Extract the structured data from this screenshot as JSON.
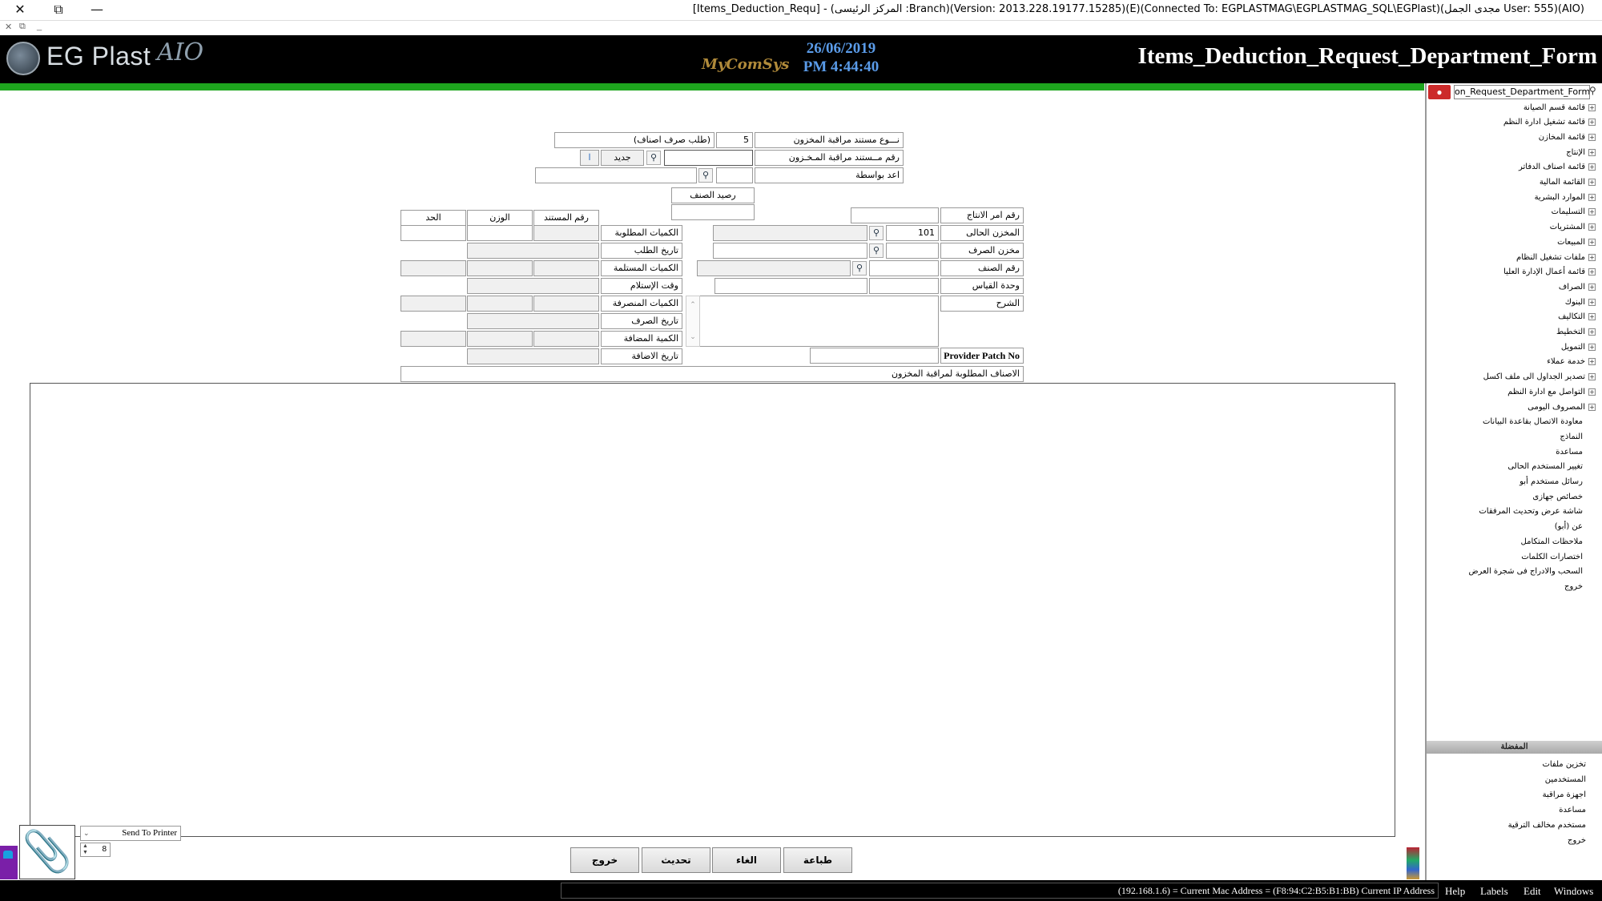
{
  "window": {
    "title": "[Items_Deduction_Requ] - (المركز الرئيسى :Branch)(Version: 2013.228.19177.15285)(E)(Connected To: EGPLASTMAG\\EGPLASTMAG_SQL\\EGPlast)(مجدى الجمل User: 555)(AIO)",
    "close": "✕",
    "restore": "⧉",
    "minimize": "—",
    "sub_close": "✕",
    "sub_restore": "⧉",
    "sub_min": "_"
  },
  "header": {
    "logo_text": "EG Plast",
    "logo_suffix": "AIO",
    "brand": "MyComSys",
    "date": "26/06/2019",
    "time": "PM 4:44:40",
    "form_title": "Items_Deduction_Request_Department_Form"
  },
  "sidebar": {
    "search_value": "on_Request_Department_Form",
    "items": [
      {
        "label": "قائمة قسم الصيانة",
        "expandable": true
      },
      {
        "label": "قائمة تشغيل ادارة النظم",
        "expandable": true
      },
      {
        "label": "قائمة المخازن",
        "expandable": true
      },
      {
        "label": "الإنتاج",
        "expandable": true
      },
      {
        "label": "قائمة اصناف الدفاتر",
        "expandable": true
      },
      {
        "label": "القائمة المالية",
        "expandable": true
      },
      {
        "label": "الموارد البشرية",
        "expandable": true
      },
      {
        "label": "التسليمات",
        "expandable": true
      },
      {
        "label": "المشتريات",
        "expandable": true
      },
      {
        "label": "المبيعات",
        "expandable": true
      },
      {
        "label": "ملفات تشغيل النظام",
        "expandable": true
      },
      {
        "label": "قائمة أعمال الإدارة العليا",
        "expandable": true
      },
      {
        "label": "الصراف",
        "expandable": true
      },
      {
        "label": "البنوك",
        "expandable": true
      },
      {
        "label": "التكاليف",
        "expandable": true
      },
      {
        "label": "التخطيط",
        "expandable": true
      },
      {
        "label": "التمويل",
        "expandable": true
      },
      {
        "label": "خدمة عملاء",
        "expandable": true
      },
      {
        "label": "تصدير الجداول الى ملف اكسل",
        "expandable": true
      },
      {
        "label": "التواصل مع ادارة النظم",
        "expandable": true
      },
      {
        "label": "المصروف اليومى",
        "expandable": true
      },
      {
        "label": "معاودة الاتصال بقاعدة البيانات",
        "expandable": false
      },
      {
        "label": "النماذج",
        "expandable": false
      },
      {
        "label": "مساعدة",
        "expandable": false
      },
      {
        "label": "تغيير المستخدم الحالى",
        "expandable": false
      },
      {
        "label": "رسائل مستخدم أبو",
        "expandable": false
      },
      {
        "label": "خصائص جهازى",
        "expandable": false
      },
      {
        "label": "شاشة عرض وتحديث المرفقات",
        "expandable": false
      },
      {
        "label": "عن (أبو)",
        "expandable": false
      },
      {
        "label": "ملاحظات المتكامل",
        "expandable": false
      },
      {
        "label": "اختصارات الكلمات",
        "expandable": false
      },
      {
        "label": "السحب والادراج فى شجرة العرض",
        "expandable": false
      },
      {
        "label": "خروج",
        "expandable": false
      }
    ],
    "favorites_title": "المفضلة",
    "favorites": [
      "تخزين ملفات",
      "المستخدمين",
      "اجهزة مراقبة",
      "مساعدة",
      "مستخدم مخالف الترقية",
      "خروج"
    ]
  },
  "form": {
    "doc_type_label": "نـــوع مستند مراقبة المخزون",
    "doc_type_code": "5",
    "doc_type_name": "(طلب صرف اصناف)",
    "doc_no_label": "رقم مــستند مراقبة المـخـزون",
    "doc_no_value": "",
    "new_label": "جديد",
    "new_aux": "ا",
    "prepared_by_label": "اعد بواسطة",
    "item_balance_label": "رصيد الصنف",
    "prod_order_label": "رقم امر الانتاج",
    "current_store_label": "المخزن الحالى",
    "current_store_value": "101",
    "issue_store_label": "مخزن الصرف",
    "item_no_label": "رقم الصنف",
    "unit_label": "وحدة القياس",
    "description_label": "الشرح",
    "provider_label": "Provider Patch No",
    "col_doc_no": "رقم المستند",
    "col_weight": "الوزن",
    "col_limit": "الحد",
    "req_qty_label": "الكميات المطلوبة",
    "req_date_label": "تاريخ الطلب",
    "recv_qty_label": "الكميات المستلمة",
    "recv_time_label": "وقت الإستلام",
    "issued_qty_label": "الكميات المنصرفة",
    "issue_date_label": "تاريخ الصرف",
    "added_qty_label": "الكمية المضافة",
    "add_date_label": "تاريخ الاضافة",
    "grid_caption": "الاصناف المطلوبة لمراقبة المخزون"
  },
  "footer": {
    "printer_label": "Send To Printer",
    "copies": "8",
    "buttons": {
      "print": "طباعة",
      "cancel": "الغاء",
      "refresh": "تحديث",
      "exit": "خروج"
    }
  },
  "statusbar": {
    "text": "(192.168.1.6) = Current Mac Address = (F8:94:C2:B5:B1:BB) Current IP Address",
    "menus": {
      "help": "Help",
      "labels": "Labels",
      "edit": "Edit",
      "windows": "Windows"
    }
  },
  "colors": {
    "accent_green": "#1ea51e",
    "header_bg": "#000000",
    "date_blue": "#5a9be8",
    "search_red": "#cc2a2a"
  }
}
